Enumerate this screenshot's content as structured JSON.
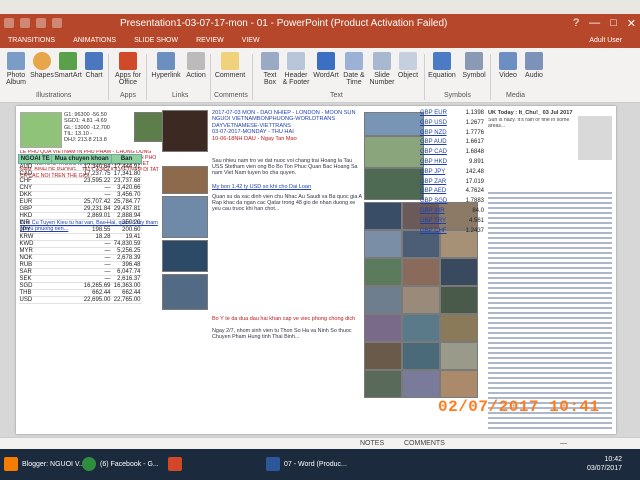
{
  "window": {
    "title": "Presentation1-03-07-17-mon - 01 - PowerPoint (Product Activation Failed)",
    "controls": [
      "?",
      "—",
      "□",
      "✕"
    ]
  },
  "ribbon": {
    "tabs": [
      "TRANSITIONS",
      "ANIMATIONS",
      "SLIDE SHOW",
      "REVIEW",
      "VIEW"
    ],
    "account": "Adult User",
    "buttons": {
      "photo": "Photo",
      "album": "Album",
      "shapes": "Shapes",
      "smartart": "SmartArt",
      "chart": "Chart",
      "apps": "Apps for",
      "apps2": "Office",
      "hyperlink": "Hyperlink",
      "action": "Action",
      "comment": "Comment",
      "textbox": "Text",
      "textbox2": "Box",
      "header": "Header",
      "header2": "& Footer",
      "wordart": "WordArt",
      "datetime": "Date &",
      "datetime2": "Time",
      "slidenum": "Slide",
      "slidenum2": "Number",
      "object": "Object",
      "equation": "Equation",
      "symbol": "Symbol",
      "video": "Video",
      "audio": "Audio"
    },
    "groups": [
      "Illustrations",
      "Apps",
      "Links",
      "Comments",
      "Text",
      "Symbols",
      "Media"
    ]
  },
  "slide": {
    "left_header": [
      "G1: 96300  -56.50",
      "SGD1: 4.81  -4.69",
      "GL: 13000  -12,700",
      "TIL: 13.10  -",
      "DHJ: 213.8  213.8"
    ],
    "left_red_text": "LE PHU QUA VIETNAM IN PHU PHAM - CHUNG DUNG QUE KHIEN THAN BINH DE PHU LE HOI QUA BINH PHO THAT NOI NHU TRUOC KHONG BUON CON CAI VIET NAM. BINH DE PHONG... TAT CA NGUOI VIETNAM DI TAT CA CAC NOI TREN THE GIOI.",
    "left_blue_text": "Cho Cu Tuyen Kieu tu hai van, Bac Hai, quan 8 tuy tham nhieu phuong tien...",
    "rates_table": {
      "headers": [
        "NGOAI TE",
        "Mua chuyen khoan",
        "Ban"
      ],
      "rows": [
        [
          "AUD",
          "17,340.64",
          "17,444.91"
        ],
        [
          "CAD",
          "17,237.75",
          "17,341.80"
        ],
        [
          "CHF",
          "23,595.22",
          "23,737.68"
        ],
        [
          "CNY",
          "—",
          "3,420.66"
        ],
        [
          "DKK",
          "—",
          "3,456.70"
        ],
        [
          "EUR",
          "25,707.42",
          "25,784.77"
        ],
        [
          "GBP",
          "29,231.84",
          "29,437.81"
        ],
        [
          "HKD",
          "2,869.01",
          "2,888.94"
        ],
        [
          "INR",
          "—",
          "350.20"
        ],
        [
          "JPY",
          "198.55",
          "200.60"
        ],
        [
          "KRW",
          "18.28",
          "19.41"
        ],
        [
          "KWD",
          "—",
          "74,830.59"
        ],
        [
          "MYR",
          "—",
          "5,256.25"
        ],
        [
          "NOK",
          "—",
          "2,678.39"
        ],
        [
          "RUB",
          "—",
          "396.48"
        ],
        [
          "SAR",
          "—",
          "6,047.74"
        ],
        [
          "SEK",
          "—",
          "2,616.37"
        ],
        [
          "SGD",
          "16,265.69",
          "16,363.00"
        ],
        [
          "THB",
          "662.44",
          "662.44"
        ],
        [
          "USD",
          "22,695.00",
          "22,765.00"
        ]
      ]
    },
    "center_top_text": [
      "2017-07-03 MON - DAO NHIEP - LONDON - MOON SUN",
      "NGUOI VIETNAMBONPHUONG-WORLDTRANS",
      "DAYVETNAMESE-VIETTRANS",
      "03-07-2017-MONDAY - THU HAI"
    ],
    "center_red_date": "10-06-18NH DAU - Ngay Tan Mao",
    "center_body": "Sau nhieu nam tro ve dat nuoc voi chang trai Hoang la Tau USS Stetham vien ong Bo Bo Ton Phuc Quan Bac Hoang Sa nam Viet Nam tuyen bo cha quyen.",
    "center_link": "My bon 1.42 ty USD so khi cho Dai Loan",
    "center_body2": "Quan su da xac dinh vien chu Nhac Au Saudi va Ba quoc gia A Rap khac da ngan cac Qatar trong 48 gio de nhan duong xe yeu cau truoc khi han chot...",
    "center_bottom_red": "Bo Y te da dua dau hai khan cap ve viec phong chong dich",
    "center_bottom_text": "Ngay 2/7, nhom sinh vien tu Thon So Ha va Ninh So thuoc Chuyen Pham Hung tinh Thai Binh...",
    "fx_rates": [
      [
        "GBP EUR",
        "1.1398"
      ],
      [
        "GBP USD",
        "1.2677"
      ],
      [
        "GBP NZD",
        "1.7776"
      ],
      [
        "GBP AUD",
        "1.6617"
      ],
      [
        "GBP CAD",
        "1.6848"
      ],
      [
        "GBP HKD",
        "9.891"
      ],
      [
        "GBP JPY",
        "142.48"
      ],
      [
        "GBP ZAR",
        "17.019"
      ],
      [
        "GBP AED",
        "4.7624"
      ],
      [
        "GBP SGD",
        "1.7883"
      ],
      [
        "GBP INR",
        "84.0"
      ],
      [
        "GBP TRY",
        "4.561"
      ],
      [
        "GBP CHF",
        "1.2437"
      ]
    ],
    "right_title": "UK Today : It_Chu!_ 03 Jul 2017",
    "right_body": "Sun is hazy. It's rain or fine in some areas...",
    "timestamp": "02/07/2017  10:41"
  },
  "status": {
    "notes": "NOTES",
    "comments": "COMMENTS",
    "zoom": "—"
  },
  "taskbar": {
    "items": [
      "Blogger: NGUOI V...",
      "(6) Facebook - G...",
      "",
      "07 - Word (Produc..."
    ],
    "time": "10:42",
    "date": "03/07/2017"
  }
}
